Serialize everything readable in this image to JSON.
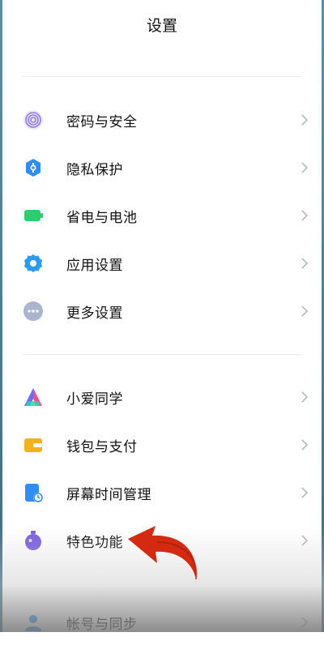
{
  "header": {
    "title": "设置"
  },
  "section1": {
    "items": [
      {
        "label": "密码与安全",
        "icon": "fingerprint-icon"
      },
      {
        "label": "隐私保护",
        "icon": "privacy-shield-icon"
      },
      {
        "label": "省电与电池",
        "icon": "battery-icon"
      },
      {
        "label": "应用设置",
        "icon": "gear-icon"
      },
      {
        "label": "更多设置",
        "icon": "more-dots-icon"
      }
    ]
  },
  "section2": {
    "items": [
      {
        "label": "小爱同学",
        "icon": "xiaoai-icon"
      },
      {
        "label": "钱包与支付",
        "icon": "wallet-icon"
      },
      {
        "label": "屏幕时间管理",
        "icon": "screen-time-icon"
      },
      {
        "label": "特色功能",
        "icon": "feature-flask-icon"
      },
      {
        "label": "帐号与同步",
        "icon": "account-icon"
      }
    ]
  },
  "colors": {
    "fingerprint": "#8e7bd9",
    "privacy": "#2f8df5",
    "battery": "#2ecc71",
    "gear": "#2d9cf0",
    "more": "#a9b4cf",
    "wallet": "#f2b21b",
    "screen_time": "#2f8df5",
    "feature": "#7b5fe0",
    "arrow": "#d42a12"
  }
}
